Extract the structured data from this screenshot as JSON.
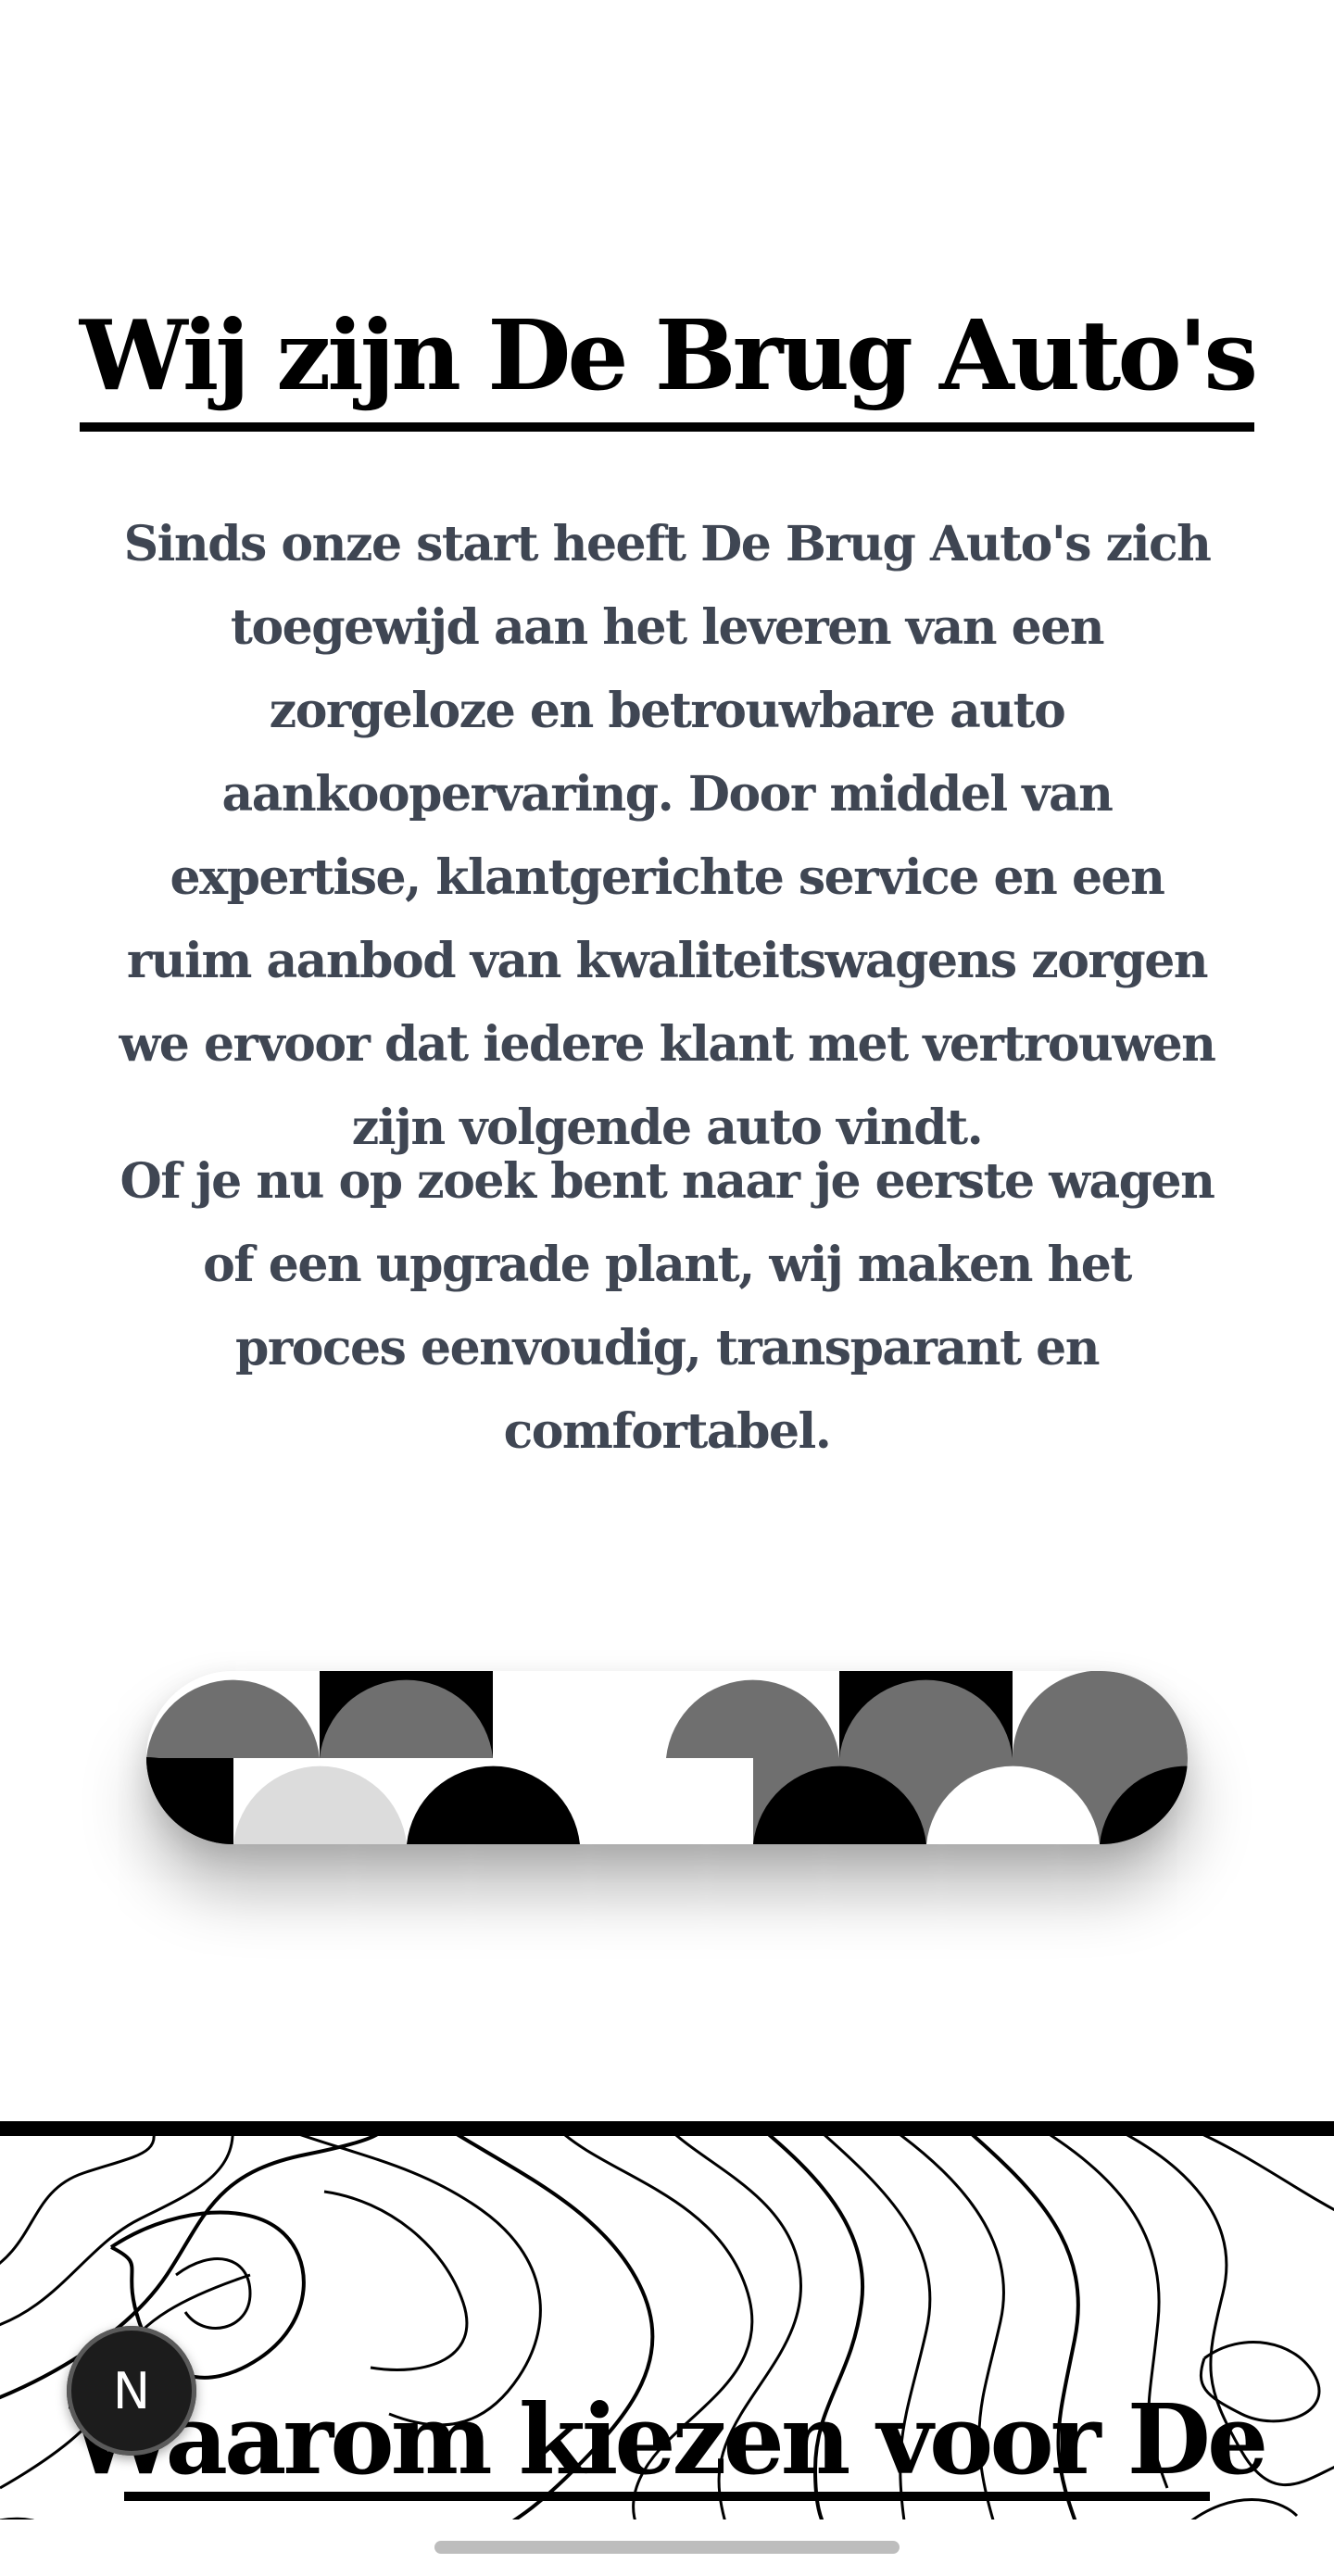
{
  "about": {
    "title": "Wij zijn De Brug Auto's",
    "paragraph_1": "Sinds onze start heeft De Brug Auto's zich toegewijd aan het leveren van een zorgeloze en betrouwbare auto aankoopervaring. Door middel van expertise, klantgerichte service en een ruim aanbod van kwaliteitswagens zorgen we ervoor dat iedere klant met vertrouwen zijn volgende auto vindt.",
    "paragraph_2": "Of je nu op zoek bent naar je eerste wagen of een upgrade plant, wij maken het proces eenvoudig, transparant en comfortabel."
  },
  "pattern": {
    "icon": "scallop-pattern",
    "colors": {
      "dark": "#000000",
      "gray": "#6f6f6f",
      "light": "#dcdcdc",
      "white": "#ffffff"
    }
  },
  "why": {
    "title": "Waarom kiezen voor De"
  },
  "badge": {
    "letter": "N",
    "icon": "next-devtools-icon"
  }
}
